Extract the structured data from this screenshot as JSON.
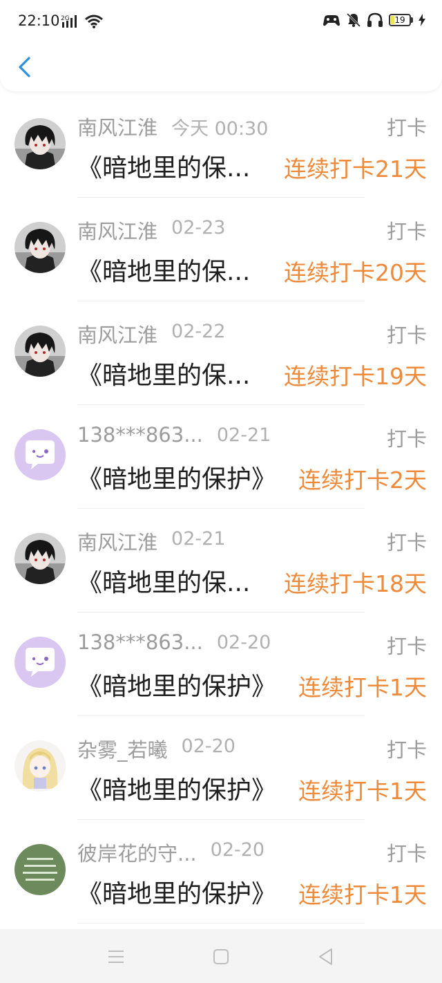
{
  "status_bar": {
    "time": "22:10",
    "network": "2G",
    "battery_level": "19",
    "battery_percent": 19,
    "battery_color": "#f3e24a",
    "icons": [
      "signal-icon",
      "wifi-icon",
      "game-mode-icon",
      "mute-icon",
      "headset-icon",
      "battery-icon",
      "charging-icon"
    ]
  },
  "header": {
    "back_icon": "chevron-left-icon",
    "accent": "#2d8fe0"
  },
  "colors": {
    "streak": "#ee8a3a",
    "meta": "#9c9c9c",
    "title": "#1e1e1e"
  },
  "entries": [
    {
      "name": "南风江淮",
      "date": "今天 00:30",
      "action": "打卡",
      "title": "《暗地里的保...",
      "streak": "连续打卡21天",
      "avatar": "dark-hair-boy-avatar"
    },
    {
      "name": "南风江淮",
      "date": "02-23",
      "action": "打卡",
      "title": "《暗地里的保...",
      "streak": "连续打卡20天",
      "avatar": "dark-hair-boy-avatar"
    },
    {
      "name": "南风江淮",
      "date": "02-22",
      "action": "打卡",
      "title": "《暗地里的保...",
      "streak": "连续打卡19天",
      "avatar": "dark-hair-boy-avatar"
    },
    {
      "name": "138***863...",
      "date": "02-21",
      "action": "打卡",
      "title": "《暗地里的保护》",
      "streak": "连续打卡2天",
      "avatar": "purple-chat-bubble-avatar"
    },
    {
      "name": "南风江淮",
      "date": "02-21",
      "action": "打卡",
      "title": "《暗地里的保...",
      "streak": "连续打卡18天",
      "avatar": "dark-hair-boy-avatar"
    },
    {
      "name": "138***863...",
      "date": "02-20",
      "action": "打卡",
      "title": "《暗地里的保护》",
      "streak": "连续打卡1天",
      "avatar": "purple-chat-bubble-avatar"
    },
    {
      "name": "杂雾_若曦",
      "date": "02-20",
      "action": "打卡",
      "title": "《暗地里的保护》",
      "streak": "连续打卡1天",
      "avatar": "blonde-anime-girl-avatar"
    },
    {
      "name": "彼岸花的守...",
      "date": "02-20",
      "action": "打卡",
      "title": "《暗地里的保护》",
      "streak": "连续打卡1天",
      "avatar": "green-text-avatar"
    }
  ],
  "nav": {
    "icons": [
      "menu-icon",
      "home-square-icon",
      "back-triangle-icon"
    ]
  }
}
